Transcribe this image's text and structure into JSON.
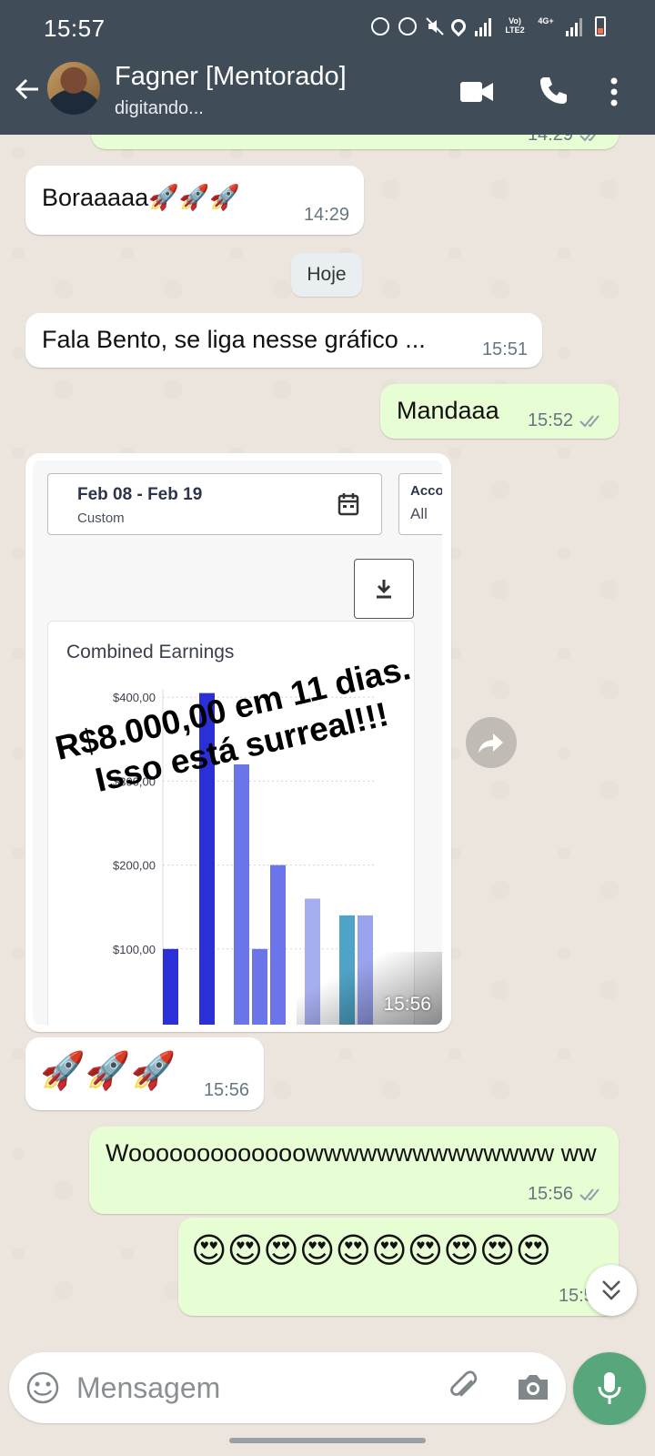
{
  "status_bar": {
    "time": "15:57",
    "lte_label": "Vo) LTE2",
    "net_label": "4G+"
  },
  "header": {
    "contact_name": "Fagner [Mentorado]",
    "status": "digitando..."
  },
  "chat": {
    "top_partial_time": "14:29",
    "date_chip": "Hoje",
    "messages": [
      {
        "direction": "in",
        "text": "Boraaaaa",
        "emoji": "🚀🚀🚀",
        "time": "14:29"
      },
      {
        "direction": "in",
        "text": "Fala Bento, se liga nesse gráfico ...",
        "time": "15:51"
      },
      {
        "direction": "out",
        "text": "Mandaaa",
        "time": "15:52"
      },
      {
        "direction": "in",
        "type": "image",
        "time": "15:56"
      },
      {
        "direction": "in",
        "emoji": "🚀🚀🚀",
        "time": "15:56"
      },
      {
        "direction": "out",
        "text": "Wooooooooooooowwwwwwwwwwwwww ww",
        "time": "15:56"
      },
      {
        "direction": "out",
        "emoji": "😍😍😍😍😍😍😍😍😍😍",
        "time": "15:56"
      }
    ]
  },
  "screenshot_image": {
    "date_range": "Feb 08 - Feb 19",
    "date_sub": "Custom",
    "account_label": "Acco",
    "account_value": "All",
    "card_title": "Combined Earnings",
    "overlay_line1": "R$8.000,00 em 11 dias.",
    "overlay_line2": "Isso está surreal!!!"
  },
  "chart_data": {
    "type": "bar",
    "title": "Combined Earnings",
    "y_tick_labels": [
      "$400,00",
      "$300,00",
      "$200,00",
      "$100,00"
    ],
    "y_ticks": [
      400,
      300,
      200,
      100
    ],
    "ylim": [
      0,
      410
    ],
    "series": [
      {
        "color": "#2b2fd8",
        "values": [
          100,
          405
        ]
      },
      {
        "color": "#6b74e8",
        "values": [
          320,
          100,
          200
        ]
      },
      {
        "color": "#a7aef0",
        "values": [
          160
        ]
      },
      {
        "color": "#4fa3c7",
        "values": [
          140
        ]
      },
      {
        "color": "#9aa3ee",
        "values": [
          140
        ]
      }
    ],
    "bars": [
      {
        "value": 100,
        "color": "#2b2fd8"
      },
      {
        "value": 405,
        "color": "#2b2fd8"
      },
      {
        "value": 320,
        "color": "#6b74e8"
      },
      {
        "value": 100,
        "color": "#6b74e8"
      },
      {
        "value": 200,
        "color": "#6b74e8"
      },
      {
        "value": 160,
        "color": "#a7aef0"
      },
      {
        "value": 140,
        "color": "#4fa3c7"
      },
      {
        "value": 140,
        "color": "#9aa3ee"
      }
    ]
  },
  "input": {
    "placeholder": "Mensagem"
  },
  "colors": {
    "header": "#404d58",
    "incoming": "#ffffff",
    "outgoing": "#e7fdd3",
    "mic": "#58a77c",
    "wallpaper": "#ece5dd"
  }
}
